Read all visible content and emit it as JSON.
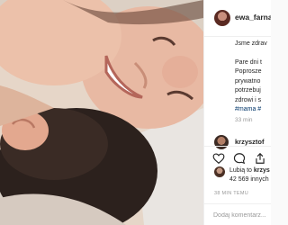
{
  "post": {
    "username": "ewa_farna",
    "caption_lines": [
      "Jsme zdrav",
      "",
      "Pare dni t",
      "Poprosze",
      "prywatno",
      "potrzebuj",
      "zdrowi i s"
    ],
    "hashtags": "#mama #",
    "posted_ago": "33 min"
  },
  "comment": {
    "username": "krzysztof"
  },
  "actions": {
    "like_icon": "heart-icon",
    "comment_icon": "comment-icon",
    "share_icon": "share-icon"
  },
  "likes": {
    "liked_by_prefix": "Lubią to ",
    "liked_by_user": "krzys",
    "count_text": "42 569 innych"
  },
  "timestamp": "38 MIN TEMU",
  "add_comment": {
    "placeholder": "Dodaj komentarz..."
  }
}
